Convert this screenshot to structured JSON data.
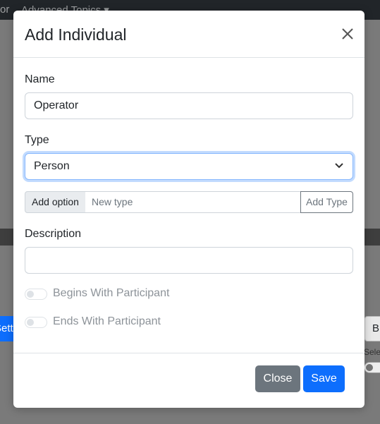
{
  "background": {
    "nav_fragment_1": "or",
    "nav_fragment_2": "Advanced Topics ▾",
    "left_button_text": "Settings",
    "right_button_text": "Br",
    "right_label_text": "Sele"
  },
  "modal": {
    "title": "Add Individual",
    "name": {
      "label": "Name",
      "value": "Operator"
    },
    "type": {
      "label": "Type",
      "selected": "Person"
    },
    "add_option": {
      "addon_label": "Add option",
      "placeholder": "New type",
      "button_label": "Add Type"
    },
    "description": {
      "label": "Description",
      "value": ""
    },
    "toggles": {
      "begins_label": "Begins With Participant",
      "ends_label": "Ends With Participant"
    },
    "footer": {
      "close_label": "Close",
      "save_label": "Save"
    }
  },
  "colors": {
    "primary": "#0d6efd",
    "secondary": "#6c757d",
    "focus_border": "#86b7fe"
  }
}
